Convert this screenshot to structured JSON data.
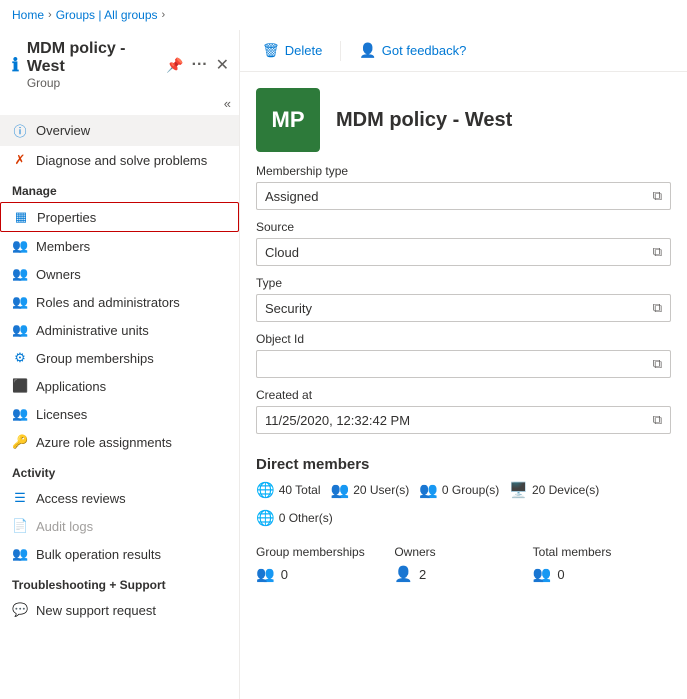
{
  "breadcrumb": {
    "items": [
      "Home",
      "Groups | All groups"
    ]
  },
  "panel": {
    "title": "MDM policy - West",
    "subtitle": "Group",
    "pin_icon": "📌",
    "more_icon": "···",
    "close_icon": "✕"
  },
  "toolbar": {
    "delete_label": "Delete",
    "feedback_label": "Got feedback?"
  },
  "avatar": {
    "text": "MP",
    "bg_color": "#2d7a3a"
  },
  "page_title": "MDM policy - West",
  "fields": [
    {
      "label": "Membership type",
      "value": "Assigned"
    },
    {
      "label": "Source",
      "value": "Cloud"
    },
    {
      "label": "Type",
      "value": "Security"
    },
    {
      "label": "Object Id",
      "value": ""
    },
    {
      "label": "Created at",
      "value": "11/25/2020, 12:32:42 PM"
    }
  ],
  "direct_members": {
    "title": "Direct members",
    "stats": [
      {
        "icon": "🌐",
        "count": "40",
        "label": "Total"
      },
      {
        "icon": "👥",
        "count": "20",
        "label": "User(s)"
      },
      {
        "icon": "👥",
        "count": "0",
        "label": "Group(s)"
      },
      {
        "icon": "🖥️",
        "count": "20",
        "label": "Device(s)"
      },
      {
        "icon": "🌐",
        "count": "0",
        "label": "Other(s)"
      }
    ]
  },
  "group_stats": [
    {
      "label": "Group memberships",
      "icon": "👥",
      "value": "0"
    },
    {
      "label": "Owners",
      "icon": "👤",
      "value": "2"
    },
    {
      "label": "Total members",
      "icon": "👥",
      "value": "0"
    }
  ],
  "sidebar": {
    "collapse_icon": "«",
    "nav_items": [
      {
        "section": null,
        "label": "Overview",
        "icon": "ℹ",
        "color": "blue",
        "active": true
      },
      {
        "section": null,
        "label": "Diagnose and solve problems",
        "icon": "✖",
        "color": "orange"
      },
      {
        "section": "Manage",
        "label": "Properties",
        "icon": "▦",
        "color": "blue",
        "selected": true
      },
      {
        "section": null,
        "label": "Members",
        "icon": "👥",
        "color": "blue"
      },
      {
        "section": null,
        "label": "Owners",
        "icon": "👥",
        "color": "blue"
      },
      {
        "section": null,
        "label": "Roles and administrators",
        "icon": "👥",
        "color": "green"
      },
      {
        "section": null,
        "label": "Administrative units",
        "icon": "👥",
        "color": "green"
      },
      {
        "section": null,
        "label": "Group memberships",
        "icon": "⚙",
        "color": "blue"
      },
      {
        "section": null,
        "label": "Applications",
        "icon": "⬛",
        "color": "blue"
      },
      {
        "section": null,
        "label": "Licenses",
        "icon": "👥",
        "color": "green"
      },
      {
        "section": null,
        "label": "Azure role assignments",
        "icon": "🔑",
        "color": "yellow"
      },
      {
        "section": "Activity",
        "label": "Access reviews",
        "icon": "☰",
        "color": "blue"
      },
      {
        "section": null,
        "label": "Audit logs",
        "icon": "📄",
        "color": "gray",
        "disabled": true
      },
      {
        "section": null,
        "label": "Bulk operation results",
        "icon": "👥",
        "color": "green"
      },
      {
        "section": "Troubleshooting + Support",
        "label": "New support request",
        "icon": "💬",
        "color": "blue"
      }
    ]
  }
}
